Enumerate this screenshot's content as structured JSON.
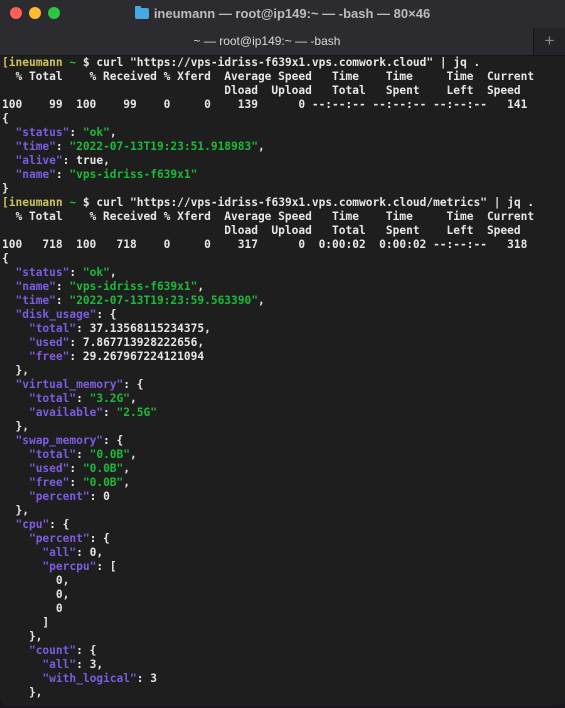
{
  "window": {
    "title": "ineumann — root@ip149:~ — -bash — 80×46",
    "tab_label": "~ — root@ip149:~ — -bash",
    "new_tab_label": "+",
    "colors": {
      "close": "#ff5f57",
      "minimize": "#febc2e",
      "zoom": "#28c840",
      "key": "#7d5ce0",
      "string": "#1bba3b",
      "prompt": "#ccc35b"
    }
  },
  "terminal": {
    "cmd1": {
      "user": "ineumann",
      "tilde": "~",
      "command": "$ curl \"https://vps-idriss-f639x1.vps.comwork.cloud\" | jq .",
      "header1": "  % Total    % Received % Xferd  Average Speed   Time    Time     Time  Current",
      "header2": "                                 Dload  Upload   Total   Spent    Left  Speed",
      "progress": "100    99  100    99    0     0    139      0 --:--:-- --:--:-- --:--:--   141"
    },
    "resp1": {
      "status": "\"ok\"",
      "time": "\"2022-07-13T19:23:51.918983\"",
      "alive": "true",
      "name": "\"vps-idriss-f639x1\""
    },
    "cmd2": {
      "user": "ineumann",
      "tilde": "~",
      "command": "$ curl \"https://vps-idriss-f639x1.vps.comwork.cloud/metrics\" | jq .",
      "header1": "  % Total    % Received % Xferd  Average Speed   Time    Time     Time  Current",
      "header2": "                                 Dload  Upload   Total   Spent    Left  Speed",
      "progress": "100   718  100   718    0     0    317      0  0:00:02  0:00:02 --:--:--   318"
    },
    "resp2": {
      "status": "\"ok\"",
      "name": "\"vps-idriss-f639x1\"",
      "time": "\"2022-07-13T19:23:59.563390\"",
      "disk_usage": {
        "total": "37.13568115234375",
        "used": "7.867713928222656",
        "free": "29.267967224121094"
      },
      "virtual_memory": {
        "total": "\"3.2G\"",
        "available": "\"2.5G\""
      },
      "swap_memory": {
        "total": "\"0.0B\"",
        "used": "\"0.0B\"",
        "free": "\"0.0B\"",
        "percent": "0"
      },
      "cpu": {
        "percent": {
          "all": "0",
          "percpu": [
            "0",
            "0",
            "0"
          ]
        },
        "count": {
          "all": "3",
          "with_logical": "3"
        }
      }
    }
  }
}
